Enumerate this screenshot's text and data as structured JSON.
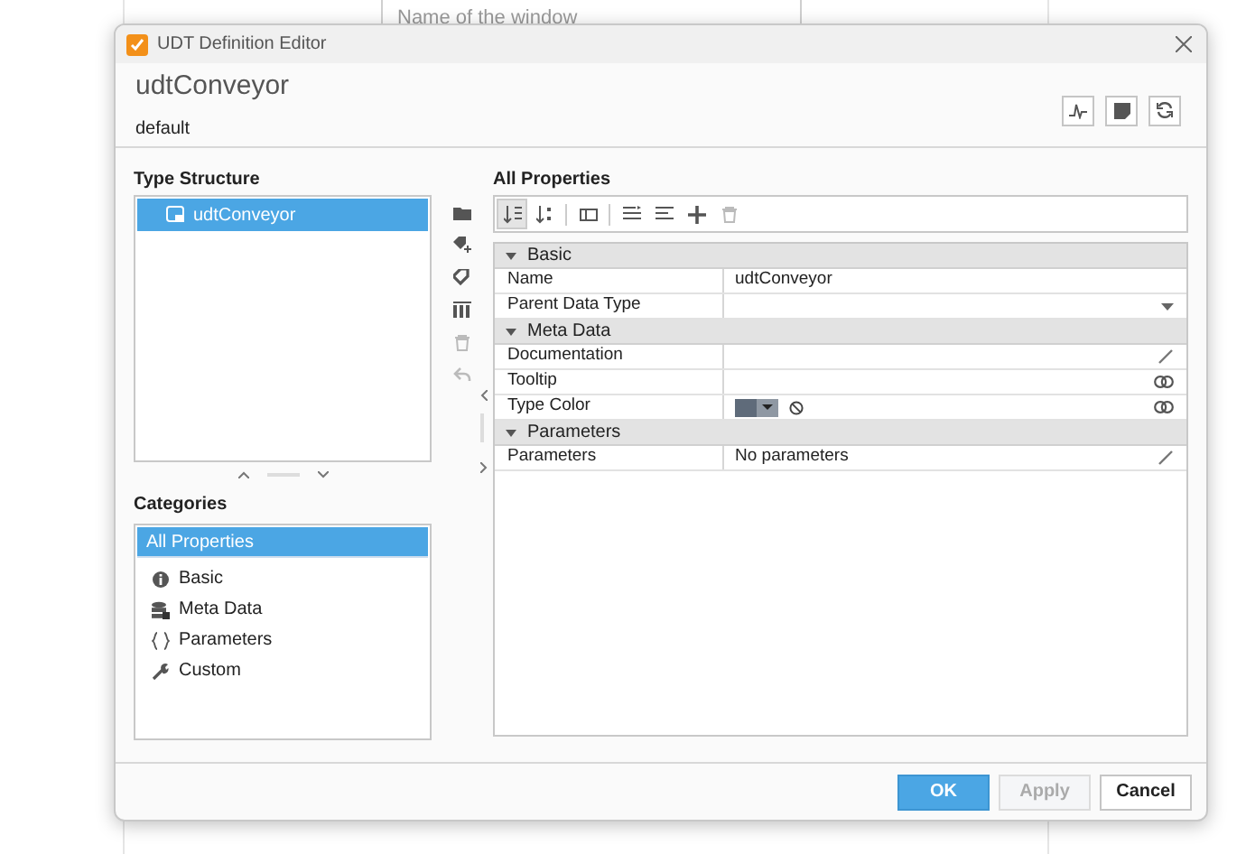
{
  "background": {
    "field_placeholder": "Name of the window"
  },
  "window": {
    "title": "UDT Definition Editor"
  },
  "header": {
    "name": "udtConveyor",
    "subtitle": "default"
  },
  "type_structure": {
    "title": "Type Structure",
    "items": [
      {
        "label": "udtConveyor",
        "selected": true
      }
    ],
    "tools": [
      {
        "kind": "folder",
        "disabled": false
      },
      {
        "kind": "tag-add",
        "disabled": false
      },
      {
        "kind": "tag",
        "disabled": false
      },
      {
        "kind": "columns",
        "disabled": false
      },
      {
        "kind": "trash",
        "disabled": true
      },
      {
        "kind": "undo",
        "disabled": true
      }
    ]
  },
  "categories": {
    "title": "Categories",
    "items": [
      {
        "label": "All Properties",
        "kind": "none",
        "selected": true
      },
      {
        "label": "Basic",
        "kind": "info",
        "selected": false
      },
      {
        "label": "Meta Data",
        "kind": "database",
        "selected": false
      },
      {
        "label": "Parameters",
        "kind": "braces",
        "selected": false
      },
      {
        "label": "Custom",
        "kind": "wrench",
        "selected": false
      }
    ]
  },
  "properties": {
    "title": "All Properties",
    "toolbar": [
      {
        "kind": "sort-asc",
        "selected": true,
        "disabled": false
      },
      {
        "kind": "sort-desc",
        "selected": false,
        "disabled": false
      },
      {
        "kind": "sep"
      },
      {
        "kind": "panel",
        "selected": false,
        "disabled": false
      },
      {
        "kind": "sep"
      },
      {
        "kind": "expand",
        "selected": false,
        "disabled": false
      },
      {
        "kind": "collapse",
        "selected": false,
        "disabled": false
      },
      {
        "kind": "plus",
        "selected": false,
        "disabled": false
      },
      {
        "kind": "trash",
        "selected": false,
        "disabled": true
      }
    ],
    "sections": [
      {
        "label": "Basic",
        "expanded": true,
        "rows": [
          {
            "name": "Name",
            "value": "udtConveyor",
            "kind": "text"
          },
          {
            "name": "Parent Data Type",
            "kind": "dropdown"
          }
        ]
      },
      {
        "label": "Meta Data",
        "expanded": true,
        "rows": [
          {
            "name": "Documentation",
            "kind": "edit"
          },
          {
            "name": "Tooltip",
            "kind": "link"
          },
          {
            "name": "Type Color",
            "kind": "color",
            "color": "#5f6b7a"
          }
        ]
      },
      {
        "label": "Parameters",
        "expanded": true,
        "rows": [
          {
            "name": "Parameters",
            "value": "No parameters",
            "kind": "edit"
          }
        ]
      }
    ]
  },
  "buttons": [
    {
      "label": "OK",
      "primary": true,
      "disabled": false
    },
    {
      "label": "Apply",
      "primary": false,
      "disabled": true
    },
    {
      "label": "Cancel",
      "primary": false,
      "disabled": false
    }
  ]
}
